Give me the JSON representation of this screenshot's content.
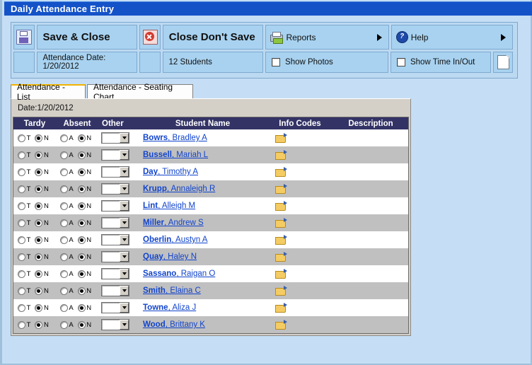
{
  "window": {
    "title": "Daily Attendance Entry"
  },
  "toolbar": {
    "save_close_label": "Save & Close",
    "close_dont_save_label": "Close Don't Save",
    "reports_label": "Reports",
    "help_label": "Help",
    "attendance_date_label": "Attendance Date:  1/20/2012",
    "student_count_label": "12 Students",
    "show_photos_label": "Show Photos",
    "show_time_label": "Show Time In/Out",
    "show_photos_checked": false,
    "show_time_checked": false,
    "icons": {
      "save": "save-floppy-icon",
      "close": "close-x-icon",
      "reports": "printer-icon",
      "help": "help-circle-icon",
      "page": "page-icon"
    }
  },
  "tabs": [
    {
      "label": "Attendance - List",
      "active": true
    },
    {
      "label": "Attendance - Seating Chart",
      "active": false
    }
  ],
  "panel": {
    "date_line": "Date:1/20/2012"
  },
  "grid": {
    "columns": [
      "Tardy",
      "Absent",
      "Other",
      "Student Name",
      "Info Codes",
      "Description"
    ],
    "radio_labels": {
      "tardy_yes": "T",
      "tardy_no": "N",
      "absent_yes": "A",
      "absent_no": "N"
    },
    "rows": [
      {
        "last": "Bowrs",
        "first": ", Bradley A",
        "tardy": "N",
        "absent": "N",
        "other": "",
        "description": ""
      },
      {
        "last": "Bussell",
        "first": ", Mariah L",
        "tardy": "N",
        "absent": "N",
        "other": "",
        "description": ""
      },
      {
        "last": "Day",
        "first": ", Timothy A",
        "tardy": "N",
        "absent": "N",
        "other": "",
        "description": ""
      },
      {
        "last": "Krupp",
        "first": ", Annaleigh R",
        "tardy": "N",
        "absent": "N",
        "other": "",
        "description": ""
      },
      {
        "last": "Lint",
        "first": ", Alleigh M",
        "tardy": "N",
        "absent": "N",
        "other": "",
        "description": ""
      },
      {
        "last": "Miller",
        "first": ", Andrew S",
        "tardy": "N",
        "absent": "N",
        "other": "",
        "description": ""
      },
      {
        "last": "Oberlin",
        "first": ", Austyn A",
        "tardy": "N",
        "absent": "N",
        "other": "",
        "description": ""
      },
      {
        "last": "Quay",
        "first": ", Haley N",
        "tardy": "N",
        "absent": "N",
        "other": "",
        "description": ""
      },
      {
        "last": "Sassano",
        "first": ", Raigan O",
        "tardy": "N",
        "absent": "N",
        "other": "",
        "description": ""
      },
      {
        "last": "Smith",
        "first": ", Elaina C",
        "tardy": "N",
        "absent": "N",
        "other": "",
        "description": ""
      },
      {
        "last": "Towne",
        "first": ", Aliza J",
        "tardy": "N",
        "absent": "N",
        "other": "",
        "description": ""
      },
      {
        "last": "Wood",
        "first": ", Brittany K",
        "tardy": "N",
        "absent": "N",
        "other": "",
        "description": ""
      }
    ]
  },
  "colors": {
    "titlebar": "#1452c8",
    "header_row": "#333366",
    "toolbar": "#a8d2f0",
    "window_bg": "#c5def5",
    "link": "#1144cc",
    "row_alt": "#c0c0c0"
  }
}
